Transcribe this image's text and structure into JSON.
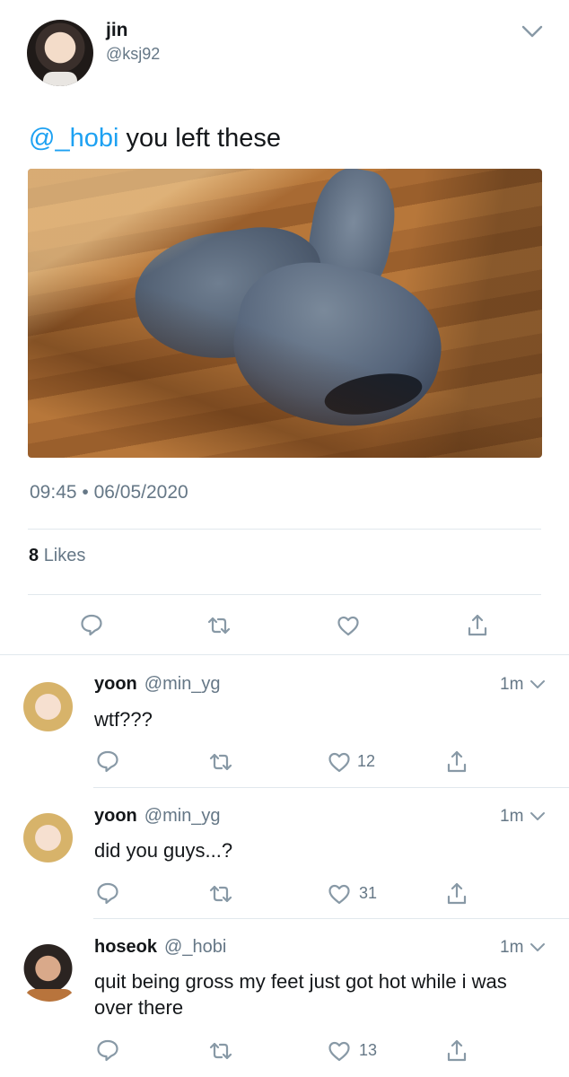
{
  "main_tweet": {
    "author_name": "jin",
    "author_handle": "@ksj92",
    "mention": "@_hobi",
    "text": " you left these",
    "timestamp": "09:45 • 06/05/2020",
    "likes_count": "8",
    "likes_label": "Likes",
    "actions": [
      "reply-icon",
      "retweet-icon",
      "like-icon",
      "share-icon"
    ]
  },
  "replies": [
    {
      "name": "yoon",
      "handle": "@min_yg",
      "time": "1m",
      "text": "wtf???",
      "like_count": "12"
    },
    {
      "name": "yoon",
      "handle": "@min_yg",
      "time": "1m",
      "text": "did you guys...?",
      "like_count": "31"
    },
    {
      "name": "hoseok",
      "handle": "@_hobi",
      "time": "1m",
      "text": "quit being gross my feet just got hot while i was over there",
      "like_count": "13"
    }
  ],
  "colors": {
    "accent": "#1da1f2",
    "secondary_text": "#657786",
    "divider": "#e1e8ed"
  }
}
